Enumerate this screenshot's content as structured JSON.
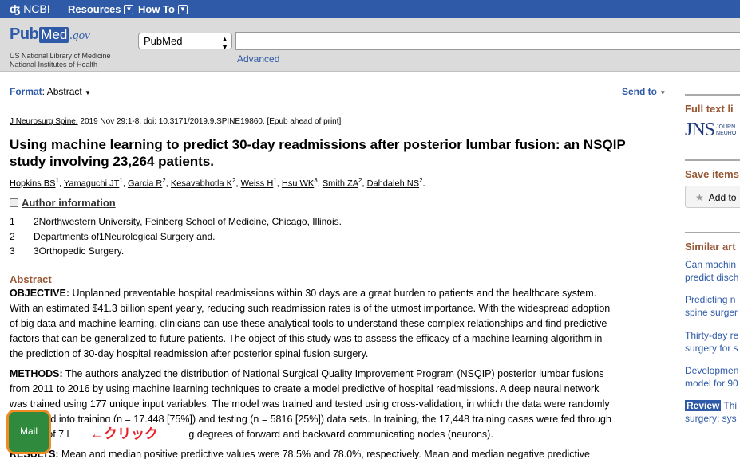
{
  "ncbi": {
    "logo": "NCBI",
    "nav": [
      {
        "label": "Resources"
      },
      {
        "label": "How To"
      }
    ]
  },
  "pubmed": {
    "logo_pub": "Pub",
    "logo_med": "Med",
    "logo_gov": ".gov",
    "nlm_line1": "US National Library of Medicine",
    "nlm_line2": "National Institutes of Health",
    "db_selected": "PubMed",
    "search_value": "",
    "advanced_label": "Advanced"
  },
  "format": {
    "label": "Format",
    "value": "Abstract",
    "send_to": "Send to"
  },
  "article": {
    "journal": "J Neurosurg Spine.",
    "citation_rest": " 2019 Nov 29:1-8. doi: 10.3171/2019.9.SPINE19860. [Epub ahead of print]",
    "title": "Using machine learning to predict 30-day readmissions after posterior lumbar fusion: an NSQIP study involving 23,264 patients.",
    "authors": [
      {
        "name": "Hopkins BS",
        "sup": "1"
      },
      {
        "name": "Yamaguchi JT",
        "sup": "1"
      },
      {
        "name": "Garcia R",
        "sup": "2"
      },
      {
        "name": "Kesavabhotla K",
        "sup": "2"
      },
      {
        "name": "Weiss H",
        "sup": "1"
      },
      {
        "name": "Hsu WK",
        "sup": "3"
      },
      {
        "name": "Smith ZA",
        "sup": "2"
      },
      {
        "name": "Dahdaleh NS",
        "sup": "2"
      }
    ],
    "author_info_label": "Author information",
    "affiliations": [
      {
        "num": "1",
        "text": "2Northwestern University, Feinberg School of Medicine, Chicago, Illinois."
      },
      {
        "num": "2",
        "text": "Departments of1Neurological Surgery and."
      },
      {
        "num": "3",
        "text": "3Orthopedic Surgery."
      }
    ],
    "abstract_label": "Abstract",
    "objective_label": "OBJECTIVE:",
    "objective_lines": [
      " Unplanned preventable hospital readmissions within 30 days are a great burden to patients and the healthcare system.",
      "With an estimated $41.3 billion spent yearly, reducing such readmission rates is of the utmost importance. With the widespread adoption",
      "of big data and machine learning, clinicians can use these analytical tools to understand these complex relationships and find predictive",
      "factors that can be generalized to future patients. The object of this study was to assess the efficacy of a machine learning algorithm in",
      "the prediction of 30-day hospital readmission after posterior spinal fusion surgery."
    ],
    "methods_label": "METHODS:",
    "methods_lines": [
      " The authors analyzed the distribution of National Surgical Quality Improvement Program (NSQIP) posterior lumbar fusions",
      "from 2011 to 2016 by using machine learning techniques to create a model predictive of hospital readmissions. A deep neural network",
      "was trained using 177 unique input variables. The model was trained and tested using cross-validation, in which the data were randomly",
      "partitioned into training (n = 17,448 [75%]) and testing (n = 5816 [25%]) data sets. In training, the 17,448 training cases were fed through",
      "a series of 7 l",
      "g degrees of forward and backward communicating nodes (neurons)."
    ],
    "results_label": "RESULTS:",
    "results_line": " Mean and median positive predictive values were 78.5% and 78.0%, respectively. Mean and median negative predictive"
  },
  "sidebar": {
    "full_text_label": "Full text li",
    "jns_big": "JNS",
    "jns_small1": "JOURN",
    "jns_small2": "NEURO",
    "save_items_label": "Save items",
    "add_to_label": "Add to",
    "similar_label": "Similar art",
    "similar": [
      {
        "l1": "Can machin",
        "l2": "predict disch"
      },
      {
        "l1": "Predicting n",
        "l2": "spine surger"
      },
      {
        "l1": "Thirty-day re",
        "l2": "surgery for s"
      },
      {
        "l1": "Developmen",
        "l2": "model for 90"
      },
      {
        "badge": "Review",
        "l1": "Thi",
        "l2": "surgery: sys"
      }
    ]
  },
  "overlay": {
    "mail_label": "Mail",
    "click_note": "←クリック"
  }
}
